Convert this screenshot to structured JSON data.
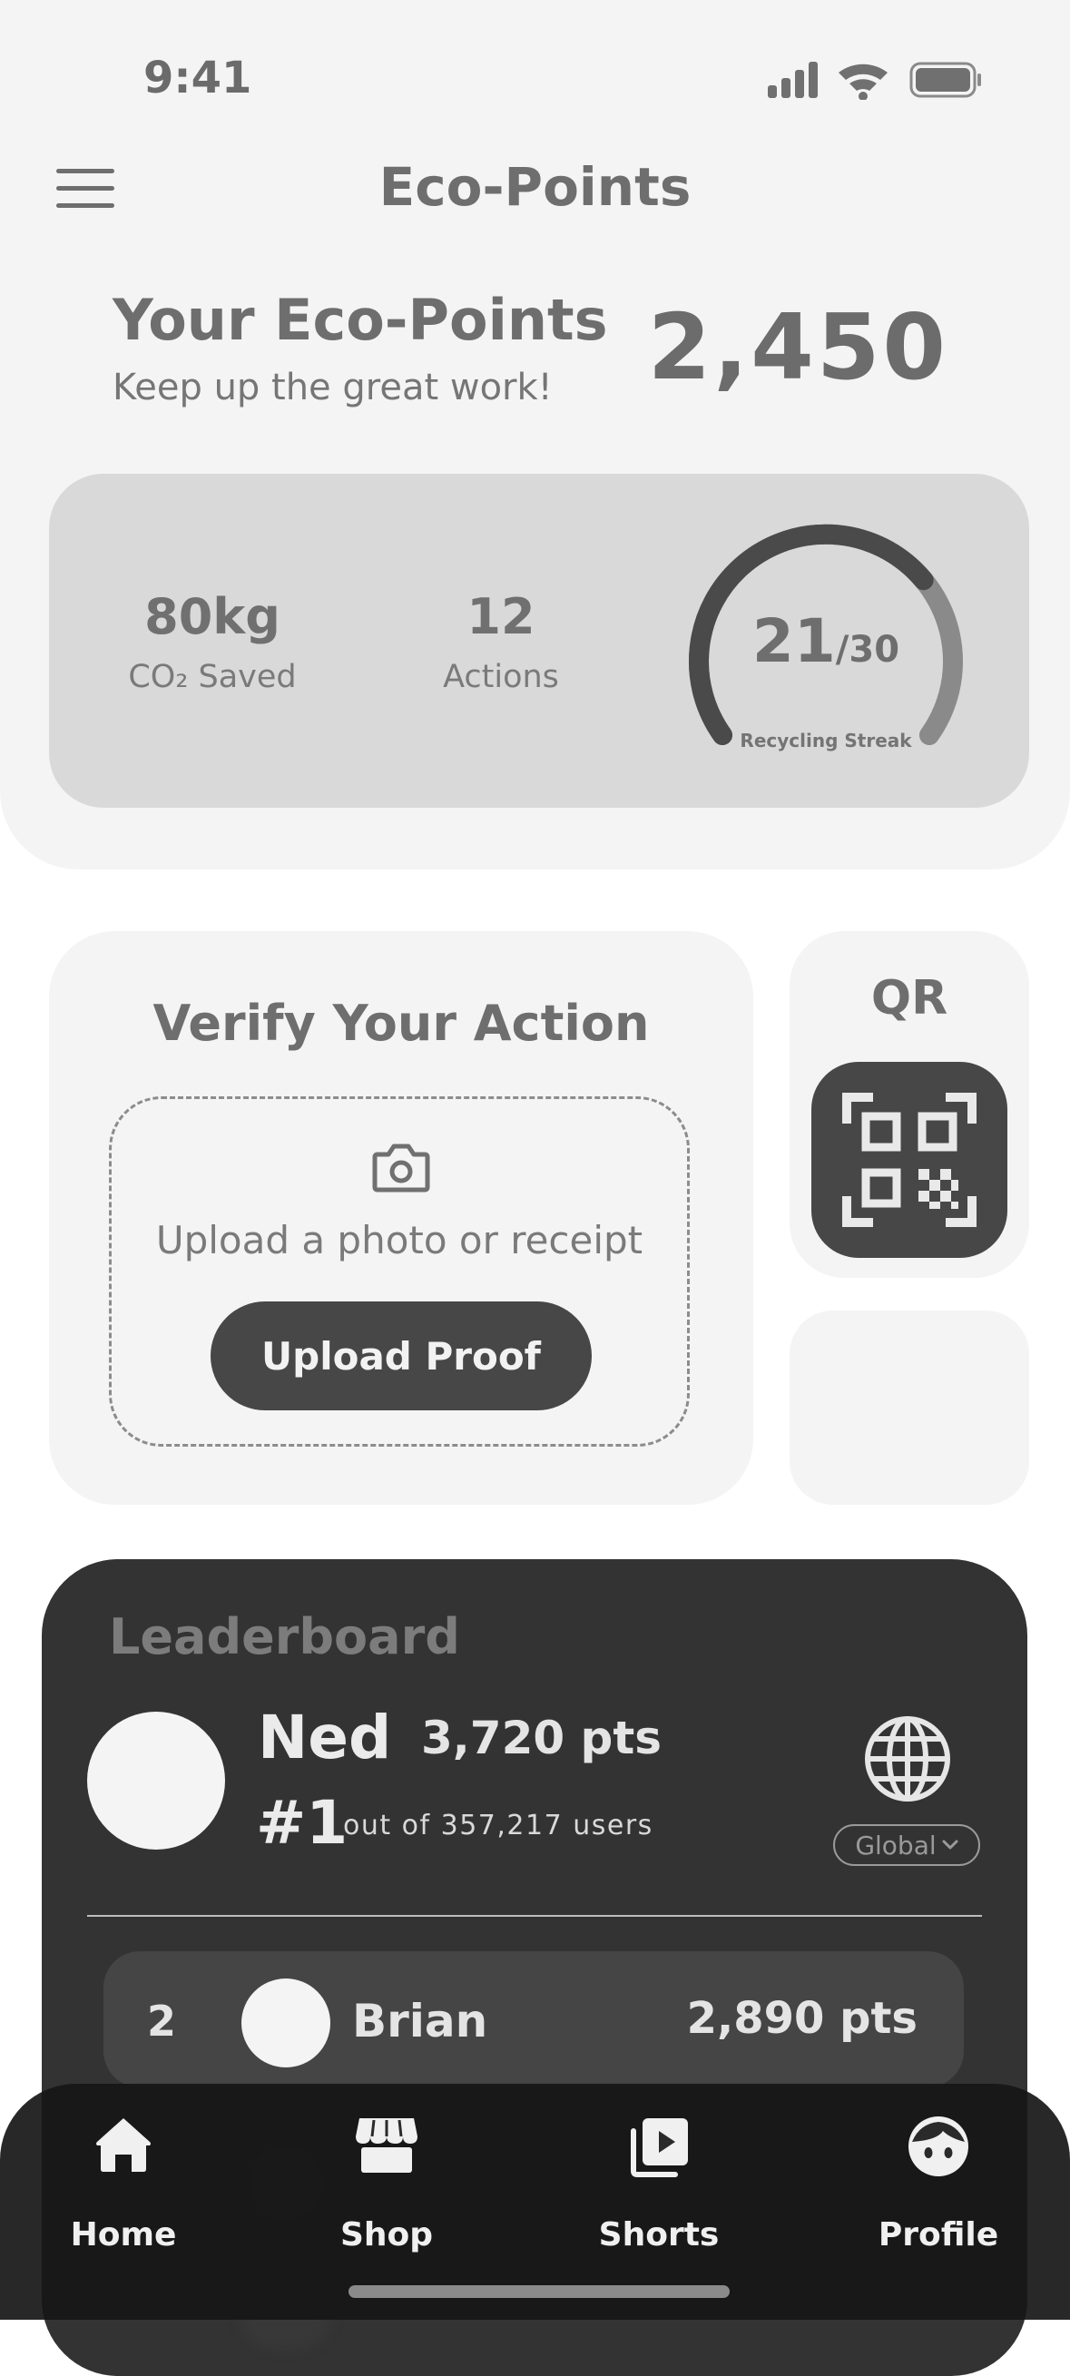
{
  "status_bar": {
    "time": "9:41"
  },
  "header": {
    "title": "Eco-Points"
  },
  "summary": {
    "title": "Your Eco-Points",
    "subtitle": "Keep up the great work!",
    "points": "2,450"
  },
  "stats": {
    "co2": {
      "value": "80kg",
      "label": "CO₂ Saved"
    },
    "actions": {
      "value": "12",
      "label": "Actions"
    },
    "streak": {
      "current": "21",
      "total": "/30",
      "label": "Recycling Streak",
      "progress": 0.7
    }
  },
  "verify": {
    "title": "Verify Your Action",
    "hint": "Upload a photo or receipt",
    "button_label": "Upload Proof"
  },
  "qr": {
    "label": "QR"
  },
  "leaderboard": {
    "title": "Leaderboard",
    "me": {
      "name": "Ned",
      "points": "3,720 pts",
      "rank": "#1",
      "out_of": "out of 357,217 users"
    },
    "scope": "Global",
    "rows": [
      {
        "rank": "2",
        "name": "Brian",
        "points": "2,890 pts"
      }
    ]
  },
  "nav": {
    "items": [
      {
        "label": "Home",
        "icon": "home-icon"
      },
      {
        "label": "Shop",
        "icon": "shop-icon"
      },
      {
        "label": "Shorts",
        "icon": "shorts-icon"
      },
      {
        "label": "Profile",
        "icon": "profile-icon"
      }
    ]
  }
}
